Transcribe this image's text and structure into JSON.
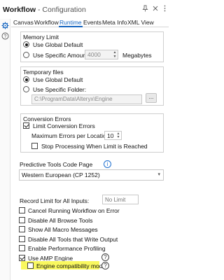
{
  "header": {
    "title_bold": "Workflow",
    "title_rest": " - Configuration",
    "pin_icon": "pin-icon",
    "close_icon": "close-icon",
    "menu_icon": "more-icon"
  },
  "rail": {
    "icons": [
      "gear-icon",
      "help-circle-icon"
    ]
  },
  "tabs": [
    {
      "label": "Canvas"
    },
    {
      "label": "Workflow"
    },
    {
      "label": "Runtime",
      "active": true
    },
    {
      "label": "Events"
    },
    {
      "label": "Meta Info"
    },
    {
      "label": "XML View"
    }
  ],
  "memory": {
    "title": "Memory Limit",
    "use_global": "Use Global Default",
    "use_specific": "Use Specific Amount:",
    "amount": "4000",
    "unit": "Megabytes"
  },
  "temp": {
    "title": "Temporary files",
    "use_global": "Use Global Default",
    "use_specific": "Use Specific Folder:",
    "folder": "C:\\ProgramData\\Alteryx\\Engine",
    "browse": "..."
  },
  "conversion": {
    "title": "Conversion Errors",
    "limit": "Limit Conversion Errors",
    "max_label": "Maximum Errors per Location:",
    "max_value": "10",
    "stop": "Stop Processing When Limit is Reached"
  },
  "predictive": {
    "label": "Predictive Tools Code Page",
    "value": "Western European (CP 1252)"
  },
  "record_limit": {
    "label": "Record Limit for All Inputs:",
    "placeholder": "No Limit"
  },
  "options": [
    {
      "label": "Cancel Running Workflow on Error",
      "checked": false
    },
    {
      "label": "Disable All Browse Tools",
      "checked": false
    },
    {
      "label": "Show All Macro Messages",
      "checked": false
    },
    {
      "label": "Disable All Tools that Write Output",
      "checked": false
    },
    {
      "label": "Enable Performance Profiling",
      "checked": false
    },
    {
      "label": "Use AMP Engine",
      "checked": true
    },
    {
      "label": "Engine compatibility mode",
      "checked": false
    }
  ],
  "colors": {
    "accent": "#1565c0",
    "highlight": "#f9f85f"
  }
}
